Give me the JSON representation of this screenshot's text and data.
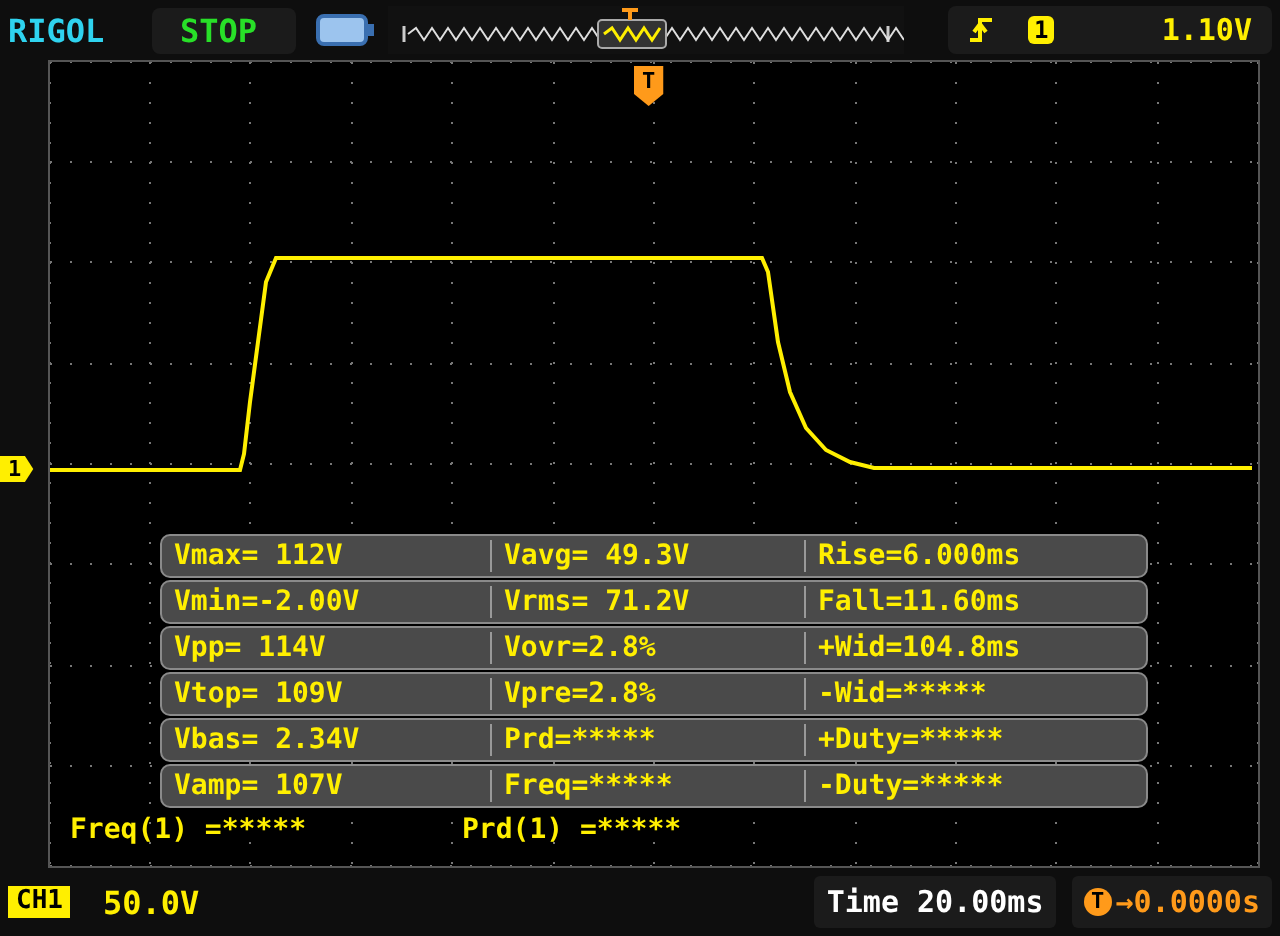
{
  "header": {
    "brand": "RIGOL",
    "run_state": "STOP",
    "trigger": {
      "source": "1",
      "level": "1.10V"
    }
  },
  "markers": {
    "channel": "1",
    "trigger": "T"
  },
  "measurements": [
    {
      "cells": [
        "Vmax= 112V",
        "Vavg= 49.3V",
        "Rise=6.000ms"
      ]
    },
    {
      "cells": [
        "Vmin=-2.00V",
        "Vrms= 71.2V",
        "Fall=11.60ms"
      ]
    },
    {
      "cells": [
        "Vpp= 114V",
        "Vovr=2.8%",
        "+Wid=104.8ms"
      ]
    },
    {
      "cells": [
        "Vtop= 109V",
        "Vpre=2.8%",
        "-Wid=*****"
      ]
    },
    {
      "cells": [
        "Vbas= 2.34V",
        "Prd=*****",
        "+Duty=*****"
      ]
    },
    {
      "cells": [
        "Vamp= 107V",
        "Freq=*****",
        "-Duty=*****"
      ]
    }
  ],
  "counters": [
    "Freq(1) =*****",
    "Prd(1) =*****"
  ],
  "status_bar": {
    "channel": "CH1",
    "scale": "50.0V",
    "timebase": "Time 20.00ms",
    "trigger_badge": "T",
    "trigger_offset": "→0.0000s"
  }
}
